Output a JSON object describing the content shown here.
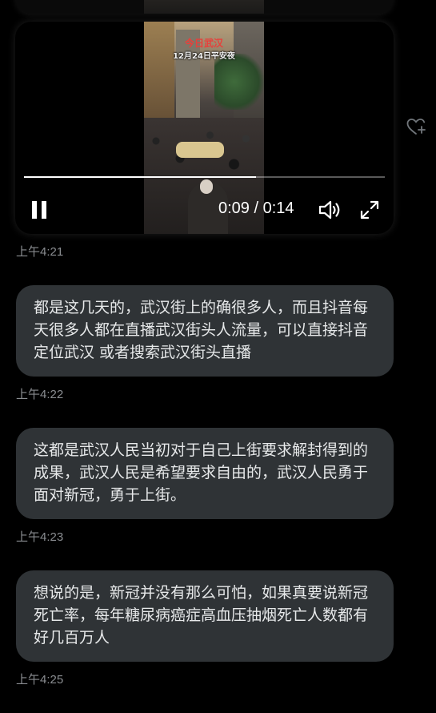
{
  "video": {
    "overlay_title": "今日武汉",
    "overlay_subtitle": "12月24日平安夜",
    "time_display": "0:09 / 0:14",
    "progress": 0.643
  },
  "messages": [
    {
      "timestamp_before": "上午4:21"
    },
    {
      "text": "都是这几天的，武汉街上的确很多人，而且抖音每天很多人都在直播武汉街头人流量，可以直接抖音定位武汉 或者搜索武汉街头直播",
      "timestamp": "上午4:22"
    },
    {
      "text": "这都是武汉人民当初对于自己上街要求解封得到的成果，武汉人民是希望要求自由的，武汉人民勇于面对新冠，勇于上街。",
      "timestamp": "上午4:23"
    },
    {
      "text": "想说的是，新冠并没有那么可怕，如果真要说新冠死亡率，每年糖尿病癌症高血压抽烟死亡人数都有好几百万人",
      "timestamp": "上午4:25"
    }
  ],
  "icons": {
    "pause": "pause-icon",
    "volume": "volume-icon",
    "fullscreen": "fullscreen-icon",
    "heart": "heart-plus-icon"
  }
}
